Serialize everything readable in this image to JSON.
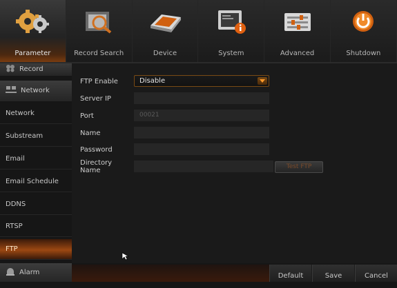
{
  "topnav": {
    "tabs": [
      {
        "label": "Parameter",
        "icon": "gears-icon"
      },
      {
        "label": "Record Search",
        "icon": "film-search-icon"
      },
      {
        "label": "Device",
        "icon": "hard-drive-icon"
      },
      {
        "label": "System",
        "icon": "system-info-icon"
      },
      {
        "label": "Advanced",
        "icon": "sliders-icon"
      },
      {
        "label": "Shutdown",
        "icon": "power-icon"
      }
    ],
    "active": "Parameter"
  },
  "sidebar": {
    "record_label": "Record",
    "network_group_label": "Network",
    "items": [
      "Network",
      "Substream",
      "Email",
      "Email Schedule",
      "DDNS",
      "RTSP",
      "FTP"
    ],
    "active_item": "FTP",
    "alarm_label": "Alarm"
  },
  "form": {
    "ftp_enable_label": "FTP Enable",
    "ftp_enable_value": "Disable",
    "server_ip_label": "Server IP",
    "server_ip_value": "",
    "port_label": "Port",
    "port_value": "00021",
    "name_label": "Name",
    "name_value": "",
    "password_label": "Password",
    "password_value": "",
    "directory_label": "Directory Name",
    "directory_value": "",
    "test_button": "Test FTP"
  },
  "footer": {
    "default_label": "Default",
    "save_label": "Save",
    "cancel_label": "Cancel"
  },
  "colors": {
    "accent": "#9c4812",
    "background": "#161616"
  }
}
